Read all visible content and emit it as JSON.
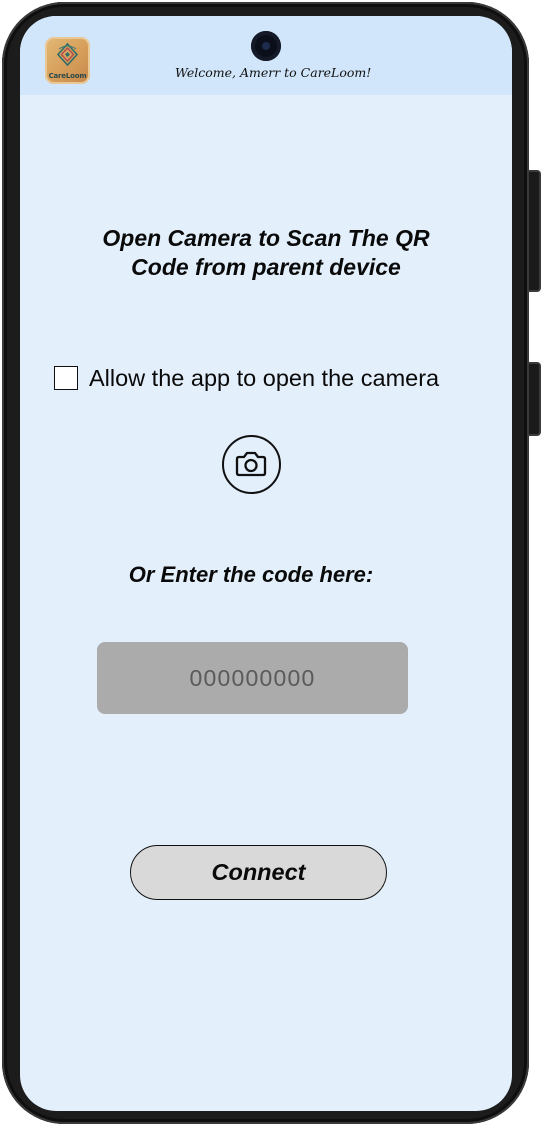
{
  "header": {
    "welcome_text": "Welcome, Amerr to CareLoom!",
    "logo_text": "CareLoom",
    "logo_icon": "careloom-logo-icon"
  },
  "main": {
    "scan_title": "Open Camera to Scan The QR Code from parent device",
    "consent_label": "Allow the app to open the camera",
    "consent_checked": false,
    "camera_icon": "camera-icon",
    "code_label": "Or Enter the code here:",
    "code_input": {
      "value": "",
      "placeholder": "000000000"
    },
    "connect_label": "Connect"
  },
  "colors": {
    "screen_background": "#e3f0fc",
    "header_background": "#d1e6fb",
    "input_background": "#ababab",
    "button_background": "#d9d9d9",
    "logo_background": "#d69e5a"
  }
}
